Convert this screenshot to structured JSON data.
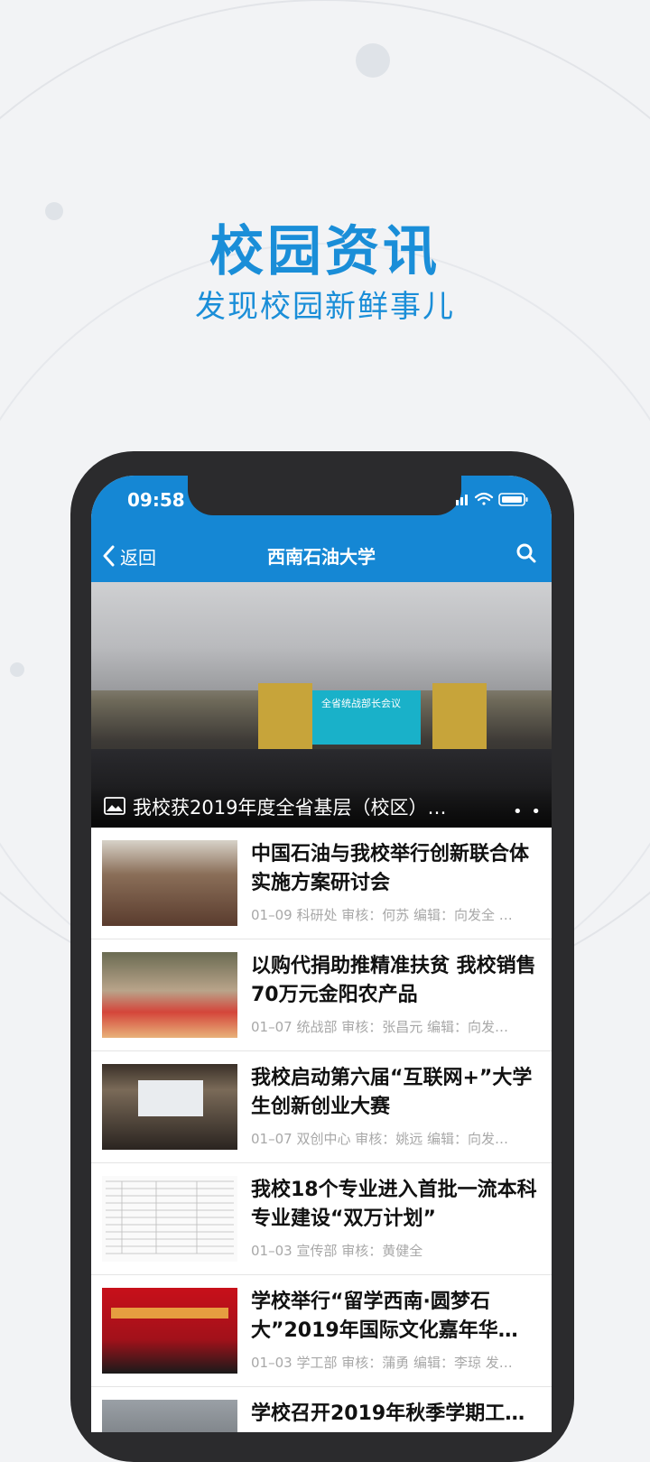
{
  "promo": {
    "title": "校园资讯",
    "subtitle": "发现校园新鲜事儿"
  },
  "status_bar": {
    "time": "09:58"
  },
  "nav": {
    "back_label": "返回",
    "title": "西南石油大学"
  },
  "hero": {
    "screen_text": "全省统战部长会议",
    "caption": "我校获2019年度全省基层（校区）…"
  },
  "news": [
    {
      "title": "中国石油与我校举行创新联合体实施方案研讨会",
      "meta": "01–09   科研处  审核：何苏  编辑：向发全 …"
    },
    {
      "title": "以购代捐助推精准扶贫 我校销售70万元金阳农产品",
      "meta": "01–07   统战部  审核：张昌元  编辑：向发…"
    },
    {
      "title": "我校启动第六届“互联网+”大学生创新创业大赛",
      "meta": "01–07   双创中心  审核：姚远  编辑：向发…"
    },
    {
      "title": "我校18个专业进入首批一流本科专业建设“双万计划”",
      "meta": "01–03   宣传部  审核：黄健全"
    },
    {
      "title": "学校举行“留学西南·圆梦石大”2019年国际文化嘉年华…",
      "meta": "01–03   学工部  审核：蒲勇  编辑：李琼  发…"
    },
    {
      "title": "学校召开2019年秋季学期工…",
      "meta": ""
    }
  ],
  "colors": {
    "accent": "#1587d4",
    "promo_text": "#1a8ed8",
    "background": "#f2f3f5",
    "phone_frame": "#2b2b2d"
  }
}
